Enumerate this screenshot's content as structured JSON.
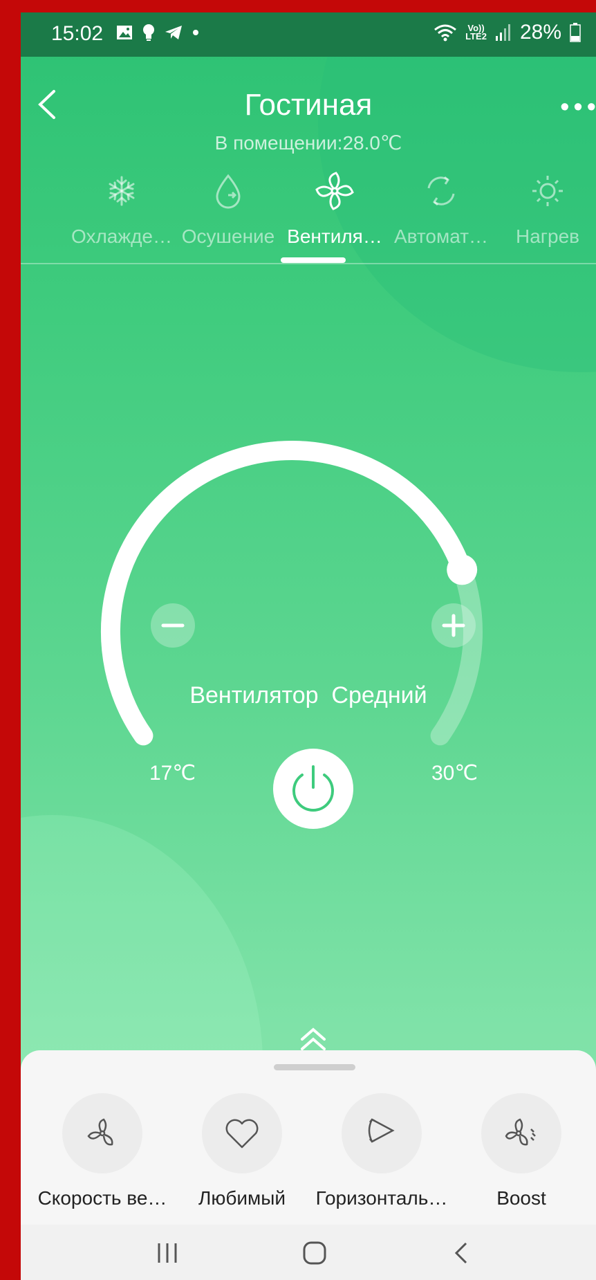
{
  "status_bar": {
    "time": "15:02",
    "network_label_top": "Vo))",
    "network_label_bottom": "LTE2",
    "battery": "28%",
    "notification_icons": [
      "image-icon",
      "bulb-icon",
      "telegram-icon",
      "dot-icon"
    ]
  },
  "header": {
    "title": "Гостиная",
    "more": "•••"
  },
  "indoor_temp": "В помещении:28.0℃",
  "modes": [
    {
      "label": "Охлажде…",
      "icon": "snowflake-icon",
      "active": false
    },
    {
      "label": "Осушение",
      "icon": "droplet-icon",
      "active": false
    },
    {
      "label": "Вентиля…",
      "icon": "fan-icon",
      "active": true
    },
    {
      "label": "Автомат…",
      "icon": "auto-cycle-icon",
      "active": false
    },
    {
      "label": "Нагрев",
      "icon": "sun-icon",
      "active": false
    }
  ],
  "dial": {
    "fan_label": "Вентилятор",
    "fan_speed": "Средний",
    "min_label": "17℃",
    "max_label": "30℃",
    "level_fraction": 0.78
  },
  "functions": [
    {
      "label": "Скорость ве…",
      "icon": "fan-speed-icon"
    },
    {
      "label": "Любимый",
      "icon": "heart-icon"
    },
    {
      "label": "Горизонталь…",
      "icon": "horizontal-swing-icon"
    },
    {
      "label": "Boost",
      "icon": "boost-icon"
    }
  ],
  "colors": {
    "accent": "#3ecb7d",
    "status_bar": "#1b7a48",
    "sheet": "#f6f6f6"
  }
}
